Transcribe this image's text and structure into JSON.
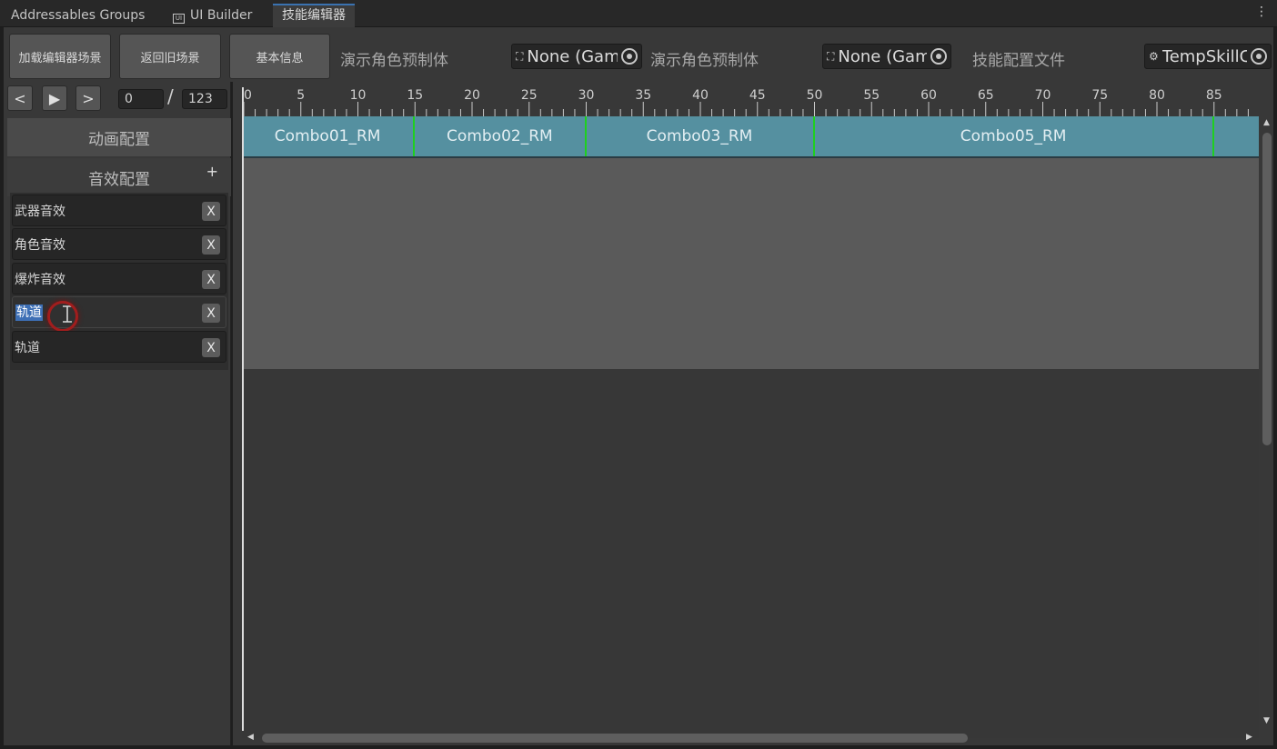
{
  "tabs": [
    {
      "label": "Addressables Groups",
      "active": false
    },
    {
      "label": "UI Builder",
      "active": false,
      "icon": "ui-builder-icon",
      "icon_text": "UI"
    },
    {
      "label": "技能编辑器",
      "active": true
    }
  ],
  "toolbar": {
    "load_scene_label": "加载编辑器场景",
    "return_scene_label": "返回旧场景",
    "basic_info_label": "基本信息",
    "preview_prefab_label_1": "演示角色预制体",
    "preview_prefab_value_1": "None (Gam",
    "preview_prefab_label_2": "演示角色预制体",
    "preview_prefab_value_2": "None (Gam",
    "skill_config_label": "技能配置文件",
    "skill_config_value": "TempSkillC"
  },
  "playback": {
    "prev_label": "<",
    "play_label": "▶",
    "next_label": ">",
    "current_frame": "0",
    "separator": "/",
    "total_frames": "123"
  },
  "sections": {
    "animation_label": "动画配置",
    "audio_label": "音效配置",
    "add_label": "+"
  },
  "audio_tracks": [
    {
      "name": "武器音效",
      "delete_label": "X"
    },
    {
      "name": "角色音效",
      "delete_label": "X"
    },
    {
      "name": "爆炸音效",
      "delete_label": "X"
    },
    {
      "name": "轨道",
      "delete_label": "X",
      "editing": true,
      "selected": true
    },
    {
      "name": "轨道",
      "delete_label": "X"
    }
  ],
  "ruler": {
    "labels": [
      "0",
      "5",
      "10",
      "15",
      "20",
      "25",
      "30",
      "35",
      "40",
      "45",
      "50",
      "55",
      "60",
      "65",
      "70",
      "75",
      "80",
      "85"
    ],
    "major_step": 5,
    "max_visible_frame": 89
  },
  "clips": [
    {
      "name": "Combo01_RM",
      "start": 0,
      "end": 15
    },
    {
      "name": "Combo02_RM",
      "start": 15,
      "end": 30
    },
    {
      "name": "Combo03_RM",
      "start": 30,
      "end": 50
    },
    {
      "name": "Combo05_RM",
      "start": 50,
      "end": 85
    },
    {
      "name": "",
      "start": 85,
      "end": 89
    }
  ],
  "colors": {
    "clip_fill": "#5590a0",
    "clip_boundary": "#1fd01f",
    "selection": "#3d6fb5",
    "cursor_highlight": "#a11d1d"
  }
}
